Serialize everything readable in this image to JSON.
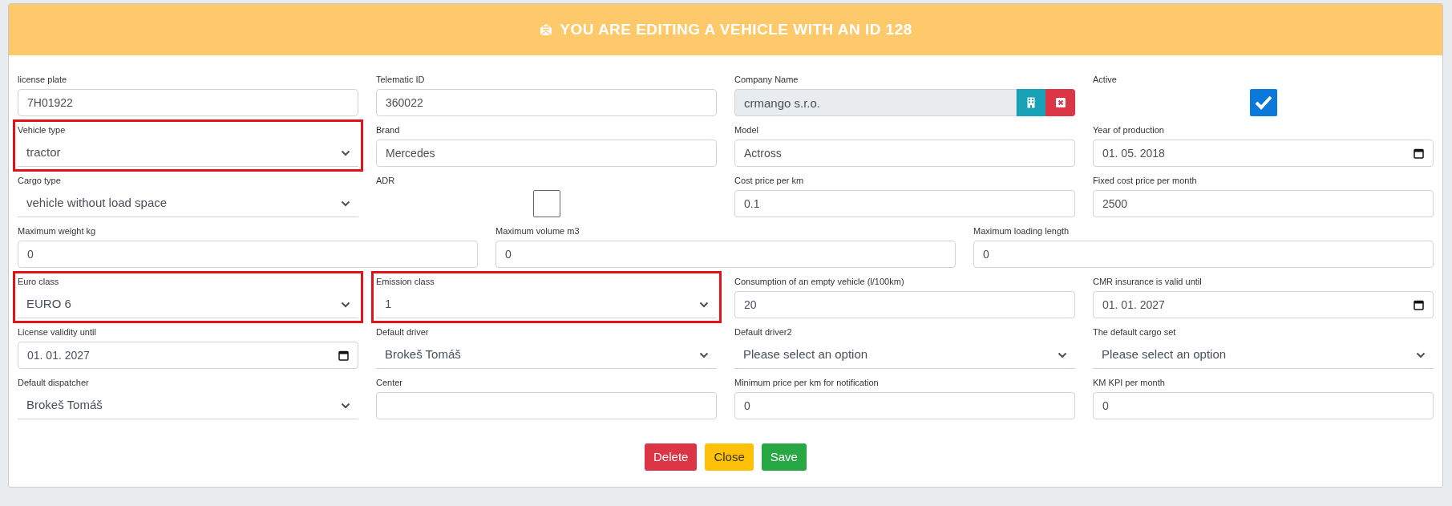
{
  "header": {
    "title": "YOU ARE EDITING A VEHICLE WITH AN ID 128"
  },
  "rows": [
    {
      "fields": [
        {
          "label": "license plate",
          "kind": "text",
          "value": "7H01922",
          "highlighted": false
        },
        {
          "label": "Telematic ID",
          "kind": "text",
          "value": "360022",
          "highlighted": false
        },
        {
          "label": "Company Name",
          "kind": "company",
          "value": "crmango s.r.o.",
          "highlighted": false
        },
        {
          "label": "Active",
          "kind": "checkbox",
          "checked": true,
          "highlighted": false
        }
      ]
    },
    {
      "fields": [
        {
          "label": "Vehicle type",
          "kind": "select",
          "value": "tractor",
          "highlighted": true
        },
        {
          "label": "Brand",
          "kind": "text",
          "value": "Mercedes",
          "highlighted": false
        },
        {
          "label": "Model",
          "kind": "text",
          "value": "Actross",
          "highlighted": false
        },
        {
          "label": "Year of production",
          "kind": "date",
          "value": "01. 05. 2018",
          "highlighted": false
        }
      ]
    },
    {
      "fields": [
        {
          "label": "Cargo type",
          "kind": "select",
          "value": "vehicle without load space",
          "highlighted": false
        },
        {
          "label": "ADR",
          "kind": "checkbox",
          "checked": false,
          "highlighted": false
        },
        {
          "label": "Cost price per km",
          "kind": "text",
          "value": "0.1",
          "highlighted": false
        },
        {
          "label": "Fixed cost price per month",
          "kind": "text",
          "value": "2500",
          "highlighted": false
        }
      ]
    },
    {
      "fields": [
        {
          "label": "Maximum weight kg",
          "kind": "text",
          "value": "0",
          "highlighted": false
        },
        {
          "label": "Maximum volume m3",
          "kind": "text",
          "value": "0",
          "highlighted": false
        },
        {
          "label": "Maximum loading length",
          "kind": "text",
          "value": "0",
          "highlighted": false
        }
      ]
    },
    {
      "fields": [
        {
          "label": "Euro class",
          "kind": "select",
          "value": "EURO 6",
          "highlighted": true
        },
        {
          "label": "Emission class",
          "kind": "select",
          "value": "1",
          "highlighted": true
        },
        {
          "label": "Consumption of an empty vehicle (l/100km)",
          "kind": "text",
          "value": "20",
          "highlighted": false
        },
        {
          "label": "CMR insurance is valid until",
          "kind": "date",
          "value": "01. 01. 2027",
          "highlighted": false
        }
      ]
    },
    {
      "fields": [
        {
          "label": "License validity until",
          "kind": "date",
          "value": "01. 01. 2027",
          "highlighted": false
        },
        {
          "label": "Default driver",
          "kind": "select",
          "value": "Brokeš Tomáš",
          "highlighted": false
        },
        {
          "label": "Default driver2",
          "kind": "select",
          "value": "Please select an option",
          "highlighted": false
        },
        {
          "label": "The default cargo set",
          "kind": "select",
          "value": "Please select an option",
          "highlighted": false
        }
      ]
    },
    {
      "fields": [
        {
          "label": "Default dispatcher",
          "kind": "select",
          "value": "Brokeš Tomáš",
          "highlighted": false
        },
        {
          "label": "Center",
          "kind": "text",
          "highlighted": false
        },
        {
          "label": "Minimum price per km for notification",
          "kind": "text",
          "value": "0",
          "highlighted": false
        },
        {
          "label": "KM KPI per month",
          "kind": "text",
          "value": "0",
          "highlighted": false
        }
      ]
    }
  ],
  "buttons": [
    {
      "label": "Delete",
      "kind": "danger"
    },
    {
      "label": "Close",
      "kind": "warning"
    },
    {
      "label": "Save",
      "kind": "success"
    }
  ]
}
